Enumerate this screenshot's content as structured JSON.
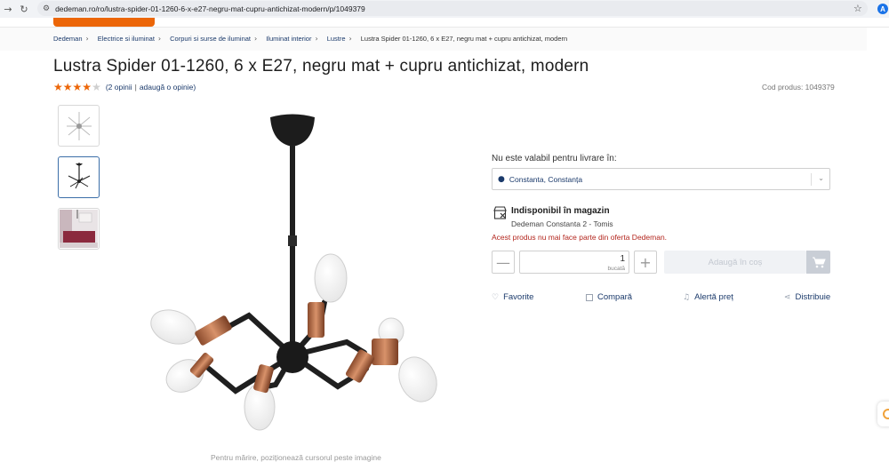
{
  "browser": {
    "url": "dedeman.ro/ro/lustra-spider-01-1260-6-x-e27-negru-mat-cupru-antichizat-modern/p/1049379",
    "profile_initial": "A"
  },
  "breadcrumb": {
    "items": [
      "Dedeman",
      "Electrice si iluminat",
      "Corpuri si surse de iluminat",
      "Iluminat interior",
      "Lustre"
    ],
    "current": "Lustra Spider 01-1260, 6 x E27, negru mat + cupru antichizat, modern"
  },
  "product": {
    "title": "Lustra Spider 01-1260, 6 x E27, negru mat + cupru antichizat, modern",
    "rating": 4,
    "rating_max": 5,
    "reviews_text": "(2 opinii",
    "separator": "|",
    "add_review_text": "adaugă o opinie)",
    "code": "Cod produs: 1049379"
  },
  "gallery": {
    "zoom_hint": "Pentru mărire, poziționează cursorul peste imagine"
  },
  "delivery": {
    "label": "Nu este valabil pentru livrare în:",
    "location": "Constanta, Constanța"
  },
  "store": {
    "availability": "Indisponibil în magazin",
    "name": "Dedeman Constanta 2 - Tomis",
    "notice": "Acest produs nu mai face parte din oferta Dedeman."
  },
  "purchase": {
    "quantity": "1",
    "unit": "bucată",
    "minus": "—",
    "plus": "+",
    "add_to_cart": "Adaugă în coș"
  },
  "actions": {
    "favorite": "Favorite",
    "compare": "Compară",
    "price_alert": "Alertă preț",
    "share": "Distribuie"
  },
  "colors": {
    "brand_orange": "#ec6608",
    "link_blue": "#1b3a6b",
    "error_red": "#b3261e"
  }
}
